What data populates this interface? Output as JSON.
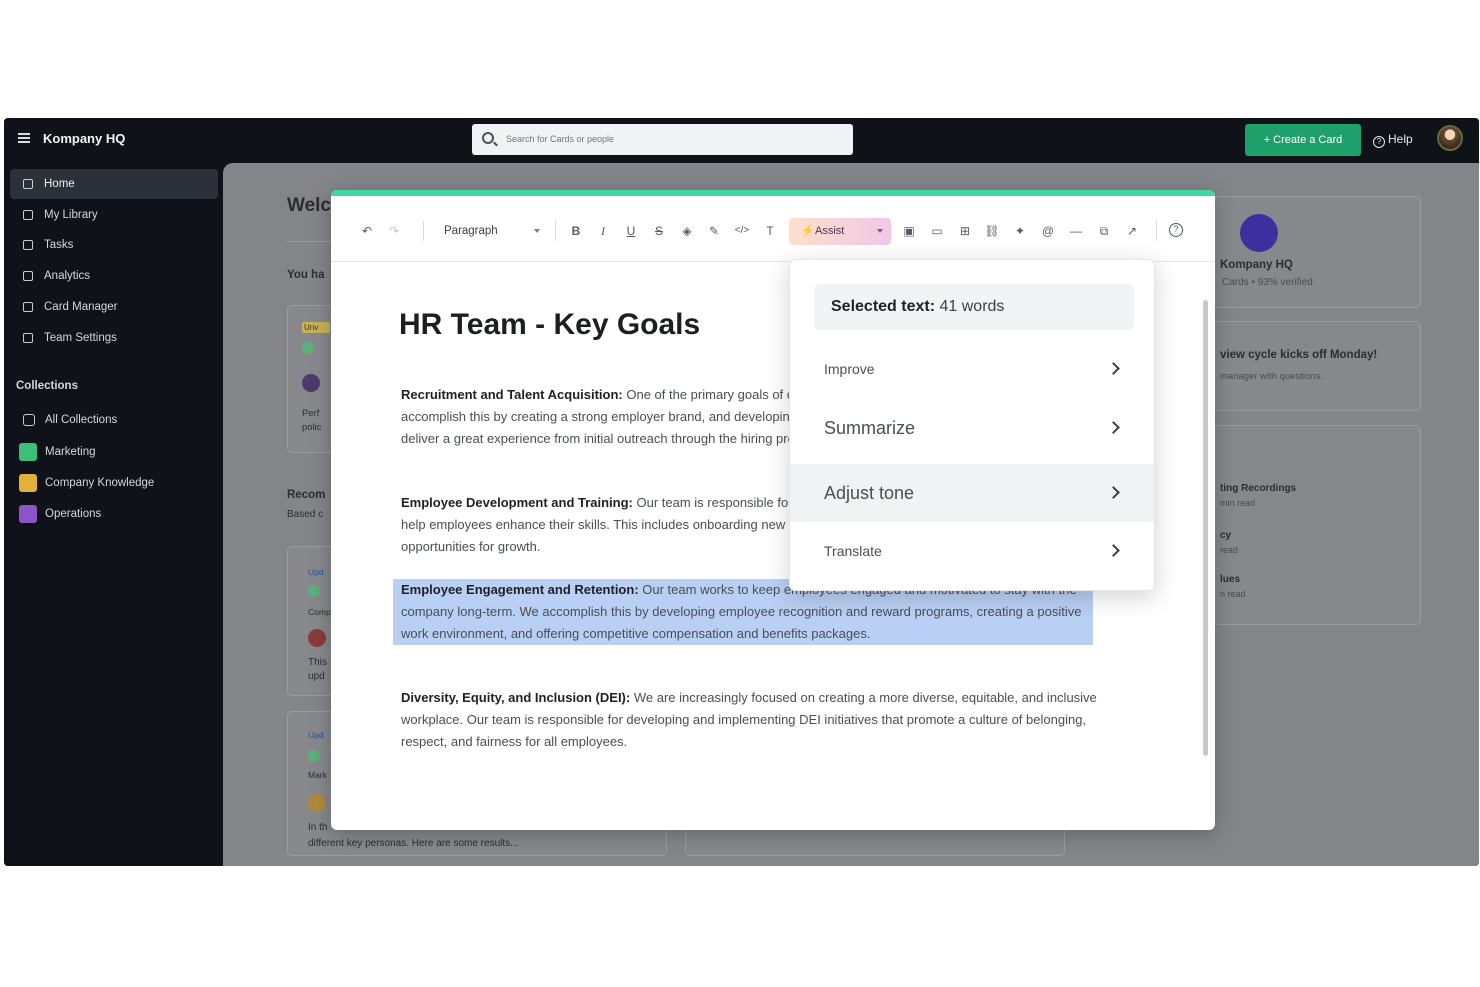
{
  "app": {
    "name": "Kompany HQ",
    "search_placeholder": "Search for Cards or people",
    "create_button": "+ Create a Card",
    "help": "Help"
  },
  "sidebar": {
    "items": [
      {
        "label": "Home",
        "icon": "home-icon"
      },
      {
        "label": "My Library",
        "icon": "bookmark-icon"
      },
      {
        "label": "Tasks",
        "icon": "tasks-icon"
      },
      {
        "label": "Analytics",
        "icon": "analytics-icon"
      },
      {
        "label": "Card Manager",
        "icon": "card-manager-icon"
      },
      {
        "label": "Team Settings",
        "icon": "gear-icon"
      }
    ],
    "collections_label": "Collections",
    "collections": [
      {
        "label": "All Collections",
        "color": "#0f1218"
      },
      {
        "label": "Marketing",
        "color": "#3dbf7a"
      },
      {
        "label": "Company Knowledge",
        "color": "#e0b23a"
      },
      {
        "label": "Operations",
        "color": "#8d53c9"
      }
    ]
  },
  "background": {
    "welcome": "Welc",
    "you_have": "You ha",
    "recommended": "Recom",
    "based_on": "Based c",
    "company_card_title": "Kompany HQ",
    "company_card_sub": "Cards • 93% verified",
    "announcement_title": "view cycle kicks off Monday!",
    "announcement_sub": "manager with questions.",
    "list_items": [
      {
        "title": "ting Recordings",
        "sub": "min read"
      },
      {
        "title": "cy",
        "sub": "read"
      },
      {
        "title": "lues",
        "sub": "n read"
      }
    ],
    "card_snippet_a": "Perf",
    "card_snippet_b": "polic",
    "card_snippet_c": "This",
    "card_snippet_d": "upd",
    "card_snippet_e": "Comp",
    "card_snippet_f": "Mark",
    "card_snippet_g": "In th",
    "card_bottom_text": "different key personas. Here are some results...",
    "badge_unverified": "Unv",
    "badge_updated": "Upd"
  },
  "editor": {
    "paragraph_style": "Paragraph",
    "assist_label": "Assist",
    "doc_title": "HR Team - Key Goals",
    "paragraphs": [
      {
        "heading": "Recruitment and Talent Acquisition:",
        "body": " One of the primary goals of our HR team is to attract and hire top talent. We accomplish this by creating a strong employer brand, and developing recruitment strategies to find the best candidates and deliver a great experience from initial outreach through the hiring process."
      },
      {
        "heading": "Employee Development and Training:",
        "body": " Our team is responsible for creating and implementing development programs that help employees enhance their skills. This includes onboarding new hires, providing ongoing training, and identifying opportunities for growth."
      },
      {
        "heading": "Employee Engagement and Retention:",
        "body": " Our team works to keep employees engaged and motivated to stay with the company long-term. We accomplish this by developing employee recognition and reward programs, creating a positive work environment, and offering competitive compensation and benefits packages."
      },
      {
        "heading": "Diversity, Equity, and Inclusion (DEI):",
        "body": " We are increasingly focused on creating a more diverse, equitable, and inclusive workplace. Our team is responsible for developing and implementing DEI initiatives that promote a culture of belonging, respect, and fairness for all employees."
      }
    ]
  },
  "assist_menu": {
    "selected_label": "Selected text:",
    "selected_count": "41 words",
    "items": [
      {
        "label": "Improve"
      },
      {
        "label": "Summarize"
      },
      {
        "label": "Adjust tone"
      },
      {
        "label": "Translate"
      }
    ]
  },
  "colors": {
    "accent_green": "#1fa06a",
    "modal_top_bar": "#3fd9a0",
    "selection": "#b9cff3"
  }
}
